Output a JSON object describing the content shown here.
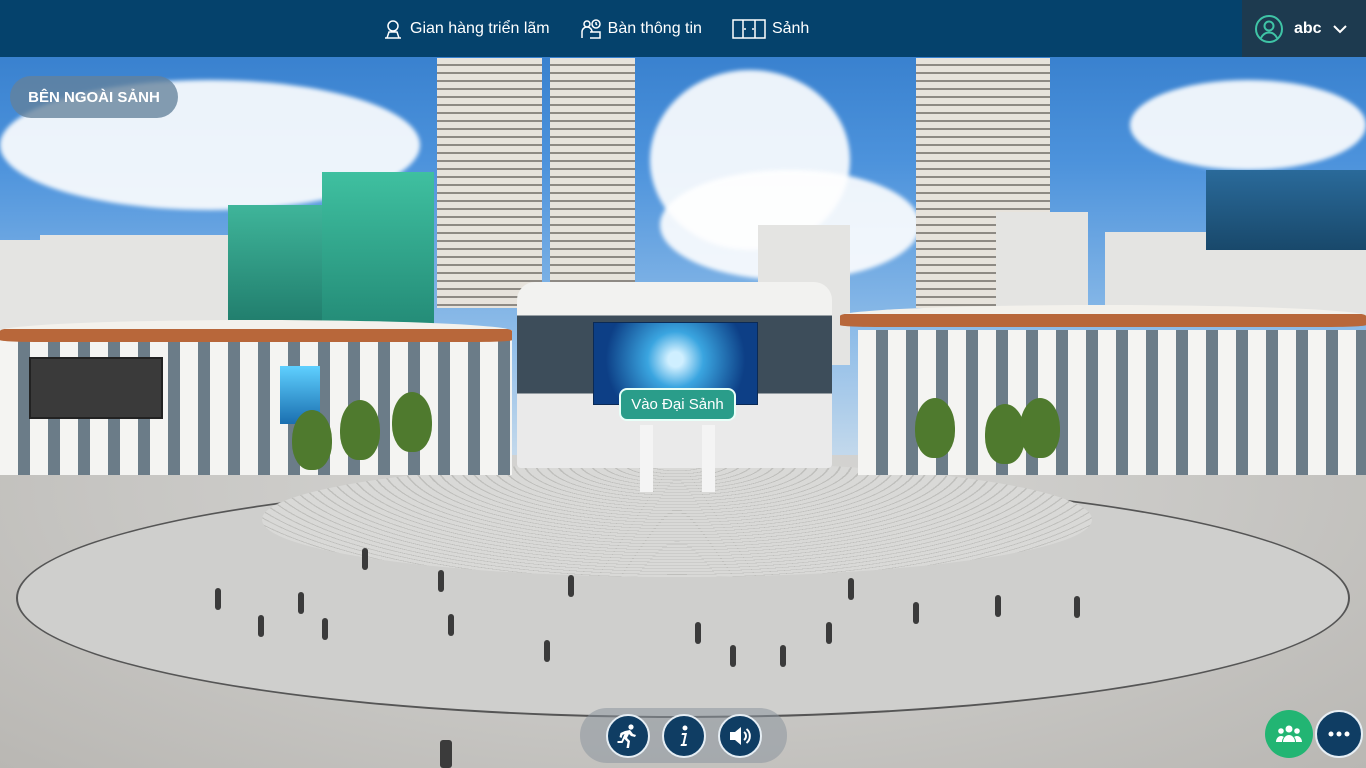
{
  "topbar": {
    "nav": [
      {
        "label": "Gian hàng triển lãm",
        "icon": "exhibition-booth-icon"
      },
      {
        "label": "Bàn thông tin",
        "icon": "info-desk-icon"
      },
      {
        "label": "Sảnh",
        "icon": "lobby-icon"
      }
    ],
    "user": {
      "name": "abc",
      "icon": "user-avatar-icon"
    }
  },
  "scene": {
    "location_label": "BÊN NGOÀI SẢNH",
    "enter_button_label": "Vào Đại Sảnh"
  },
  "controls": [
    {
      "name": "walk-button",
      "icon": "running-person-icon"
    },
    {
      "name": "info-button",
      "icon": "info-icon"
    },
    {
      "name": "sound-button",
      "icon": "speaker-icon"
    }
  ],
  "fabs": [
    {
      "name": "people-button",
      "icon": "people-group-icon"
    },
    {
      "name": "more-button",
      "icon": "ellipsis-icon"
    }
  ],
  "colors": {
    "topbar": "#05426c",
    "user_panel": "#1d3a4f",
    "enter_button": "#2a9d8a",
    "people_fab": "#22b573",
    "control_button": "#0f3d63"
  }
}
